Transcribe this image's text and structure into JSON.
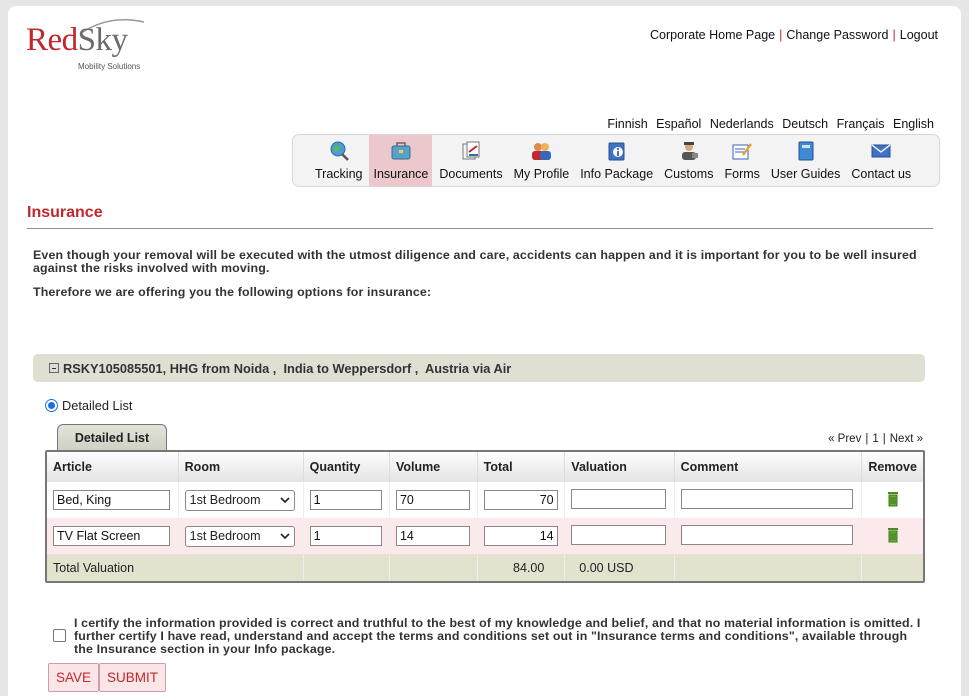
{
  "brand": {
    "name_part1": "Red",
    "name_part2": "Sky",
    "tagline": "Mobility Solutions"
  },
  "top_links": [
    "Corporate Home Page",
    "Change Password",
    "Logout"
  ],
  "languages": [
    "Finnish",
    "Español",
    "Nederlands",
    "Deutsch",
    "Français",
    "English"
  ],
  "nav": [
    {
      "label": "Tracking",
      "icon": "globe-magnifier-icon",
      "active": false
    },
    {
      "label": "Insurance",
      "icon": "briefcase-icon",
      "active": true
    },
    {
      "label": "Documents",
      "icon": "documents-icon",
      "active": false
    },
    {
      "label": "My Profile",
      "icon": "people-icon",
      "active": false
    },
    {
      "label": "Info Package",
      "icon": "info-book-icon",
      "active": false
    },
    {
      "label": "Customs",
      "icon": "customs-officer-icon",
      "active": false
    },
    {
      "label": "Forms",
      "icon": "forms-icon",
      "active": false
    },
    {
      "label": "User Guides",
      "icon": "guide-book-icon",
      "active": false
    },
    {
      "label": "Contact us",
      "icon": "envelope-icon",
      "active": false
    }
  ],
  "page_title": "Insurance",
  "intro_text": "Even though your removal will be executed with the utmost diligence and care, accidents can happen and it is important for you to be well insured against the risks involved with moving.",
  "intro_text2": "Therefore we are offering you the following options for insurance:",
  "shipment": "RSKY105085501, HHG from Noida ,  India to Weppersdorf ,  Austria via Air",
  "list_option": "Detailed List",
  "tab_label": "Detailed List",
  "pager": {
    "prev": "« Prev",
    "sep1": "|",
    "page": "1",
    "sep2": "|",
    "next": "Next »"
  },
  "table": {
    "headers": [
      "Article",
      "Room",
      "Quantity",
      "Volume",
      "Total",
      "Valuation",
      "Comment",
      "Remove"
    ],
    "rows": [
      {
        "article": "Bed, King",
        "room": "1st Bedroom",
        "quantity": "1",
        "volume": "70",
        "total": "70",
        "valuation": "",
        "comment": ""
      },
      {
        "article": "TV Flat Screen",
        "room": "1st Bedroom",
        "quantity": "1",
        "volume": "14",
        "total": "14",
        "valuation": "",
        "comment": ""
      }
    ],
    "total_label": "Total Valuation",
    "total_value": "84.00",
    "total_valuation": "0.00 USD"
  },
  "certify_text": "I certify the information provided is correct and truthful to the best of my knowledge and belief, and that no material information is omitted. I further certify I have read, understand and accept the terms and conditions set out in \"Insurance terms and conditions\", available through the Insurance section in your Info package.",
  "buttons": {
    "save": "SAVE",
    "submit": "SUBMIT"
  },
  "colors": {
    "brand_red": "#c0282d",
    "active_tab": "#ecc8cd",
    "row_alt": "#fbe9ec",
    "total_row": "#e3e2cf"
  }
}
